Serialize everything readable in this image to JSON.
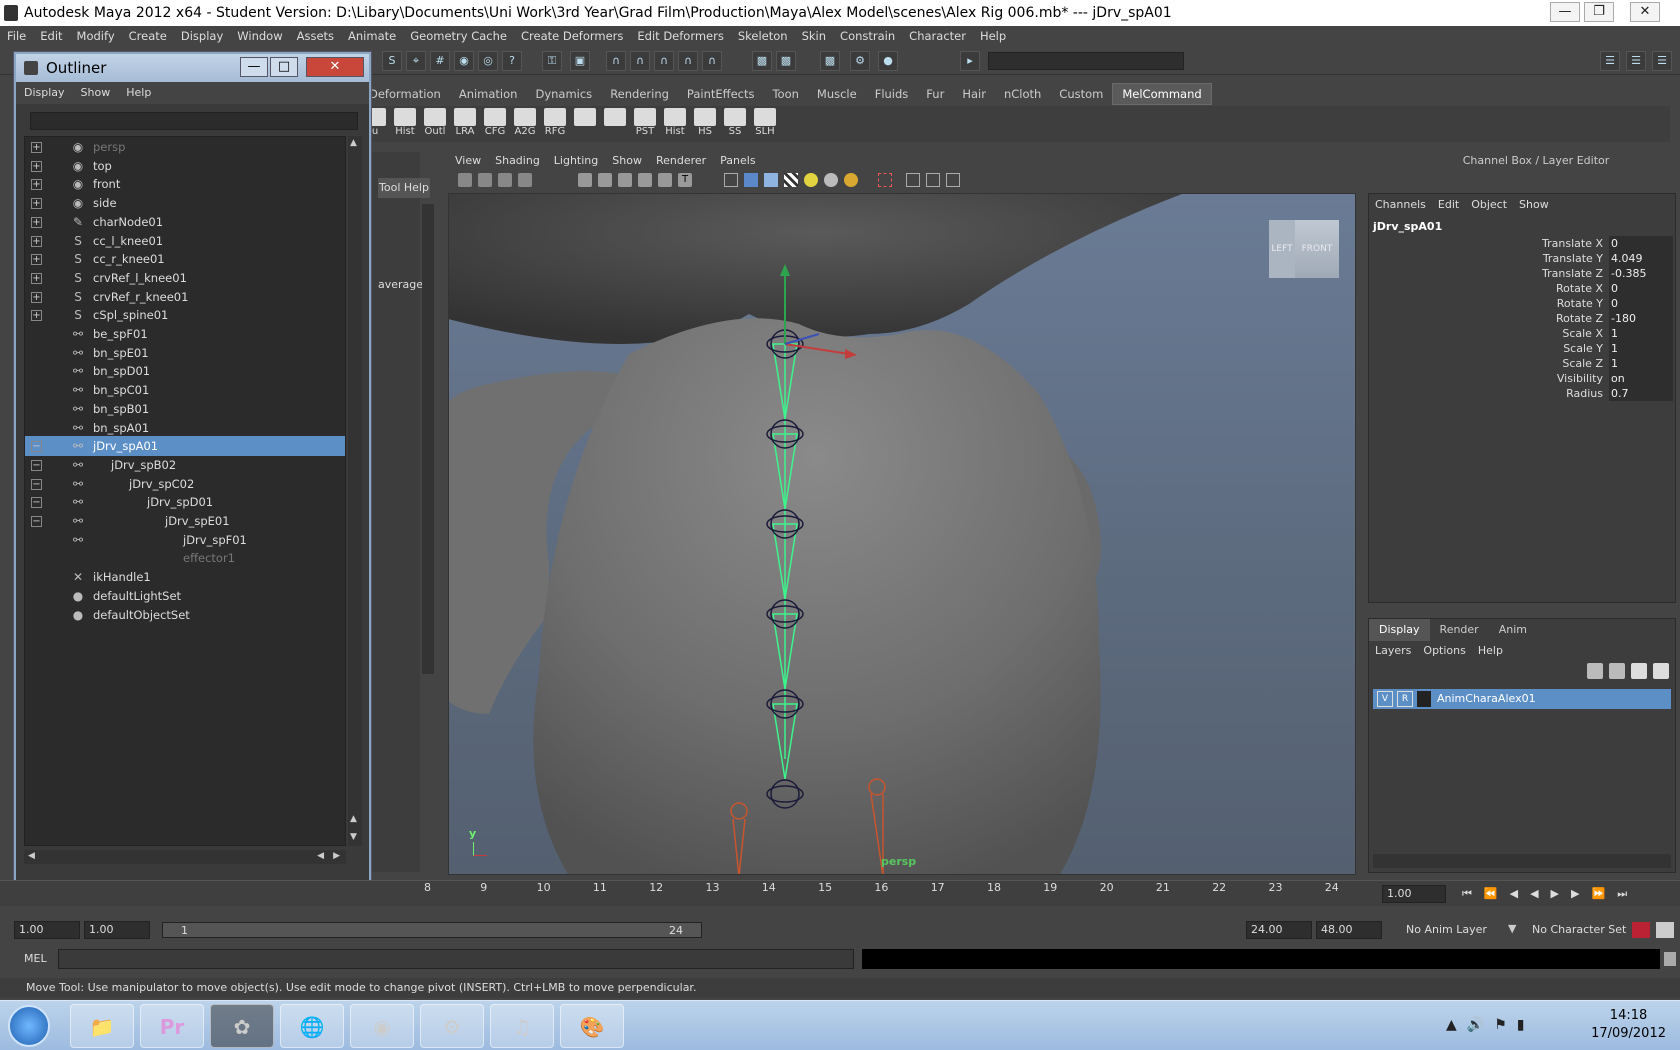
{
  "window": {
    "title": "Autodesk Maya 2012 x64 - Student Version: D:\\Libary\\Documents\\Uni Work\\3rd Year\\Grad Film\\Production\\Maya\\Alex Model\\scenes\\Alex Rig 006.mb*   ---   jDrv_spA01"
  },
  "menubar": [
    "File",
    "Edit",
    "Modify",
    "Create",
    "Display",
    "Window",
    "Assets",
    "Animate",
    "Geometry Cache",
    "Create Deformers",
    "Edit Deformers",
    "Skeleton",
    "Skin",
    "Constrain",
    "Character",
    "Help"
  ],
  "shelf_tabs": [
    "Deformation",
    "Animation",
    "Dynamics",
    "Rendering",
    "PaintEffects",
    "Toon",
    "Muscle",
    "Fluids",
    "Fur",
    "Hair",
    "nCloth",
    "Custom",
    "MelCommand"
  ],
  "shelf_selected": "MelCommand",
  "shelf_buttons": [
    "u",
    "Hist",
    "Outl",
    "LRA",
    "CFG",
    "A2G",
    "RFG",
    "",
    "",
    "PST",
    "Hist",
    "HS",
    "SS",
    "SLH"
  ],
  "outliner": {
    "title": "Outliner",
    "menu": [
      "Display",
      "Show",
      "Help"
    ],
    "items": [
      {
        "label": "persp",
        "dim": true
      },
      {
        "label": "top"
      },
      {
        "label": "front"
      },
      {
        "label": "side"
      },
      {
        "label": "charNode01"
      },
      {
        "label": "cc_l_knee01"
      },
      {
        "label": "cc_r_knee01"
      },
      {
        "label": "crvRef_l_knee01"
      },
      {
        "label": "crvRef_r_knee01"
      },
      {
        "label": "cSpl_spine01"
      },
      {
        "label": "be_spF01"
      },
      {
        "label": "bn_spE01"
      },
      {
        "label": "bn_spD01"
      },
      {
        "label": "bn_spC01"
      },
      {
        "label": "bn_spB01"
      },
      {
        "label": "bn_spA01"
      },
      {
        "label": "jDrv_spA01",
        "selected": true
      },
      {
        "label": "jDrv_spB02"
      },
      {
        "label": "jDrv_spC02"
      },
      {
        "label": "jDrv_spD01"
      },
      {
        "label": "jDrv_spE01"
      },
      {
        "label": "jDrv_spF01"
      },
      {
        "label": "effector1",
        "dim": true
      },
      {
        "label": "ikHandle1"
      },
      {
        "label": "defaultLightSet"
      },
      {
        "label": "defaultObjectSet"
      }
    ]
  },
  "tool_help": "Tool Help",
  "tool_average": "average",
  "viewport": {
    "menu": [
      "View",
      "Shading",
      "Lighting",
      "Show",
      "Renderer",
      "Panels"
    ],
    "camera": "persp",
    "cube_left": "LEFT",
    "cube_front": "FRONT",
    "axis_y": "y"
  },
  "channel_box": {
    "header": "Channel Box / Layer Editor",
    "menu": [
      "Channels",
      "Edit",
      "Object",
      "Show"
    ],
    "object": "jDrv_spA01",
    "channels": [
      {
        "name": "Translate X",
        "value": "0"
      },
      {
        "name": "Translate Y",
        "value": "4.049"
      },
      {
        "name": "Translate Z",
        "value": "-0.385"
      },
      {
        "name": "Rotate X",
        "value": "0"
      },
      {
        "name": "Rotate Y",
        "value": "0"
      },
      {
        "name": "Rotate Z",
        "value": "-180"
      },
      {
        "name": "Scale X",
        "value": "1"
      },
      {
        "name": "Scale Y",
        "value": "1"
      },
      {
        "name": "Scale Z",
        "value": "1"
      },
      {
        "name": "Visibility",
        "value": "on"
      },
      {
        "name": "Radius",
        "value": "0.7"
      }
    ]
  },
  "layers": {
    "tabs": [
      "Display",
      "Render",
      "Anim"
    ],
    "menu": [
      "Layers",
      "Options",
      "Help"
    ],
    "items": [
      {
        "v": "V",
        "r": "R",
        "name": "AnimCharaAlex01"
      }
    ]
  },
  "timeline": {
    "ticks": [
      "8",
      "9",
      "10",
      "11",
      "12",
      "13",
      "14",
      "15",
      "16",
      "17",
      "18",
      "19",
      "20",
      "21",
      "22",
      "23",
      "24"
    ],
    "current": "1.00"
  },
  "range": {
    "start": "1.00",
    "start2": "1.00",
    "slider_start": "1",
    "slider_end": "24",
    "end": "24.00",
    "end2": "48.00",
    "anim_layer": "No Anim Layer",
    "char_set": "No Character Set"
  },
  "mel": {
    "label": "MEL"
  },
  "help_line": "Move Tool: Use manipulator to move object(s). Use edit mode to change pivot (INSERT).  Ctrl+LMB to move perpendicular.",
  "taskbar": {
    "time": "14:18",
    "date": "17/09/2012"
  }
}
